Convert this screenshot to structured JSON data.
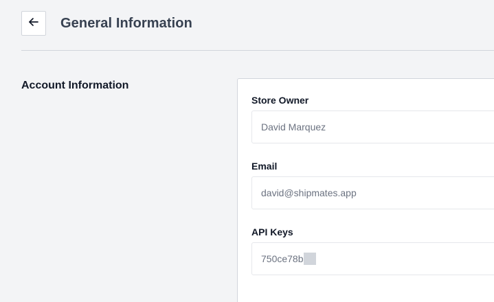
{
  "header": {
    "back_icon": "arrow-left-icon",
    "title": "General Information"
  },
  "section": {
    "title": "Account Information"
  },
  "fields": {
    "store_owner": {
      "label": "Store Owner",
      "value": "David Marquez"
    },
    "email": {
      "label": "Email",
      "value": "david@shipmates.app"
    },
    "api_keys": {
      "label": "API Keys",
      "value": "750ce78b"
    }
  }
}
